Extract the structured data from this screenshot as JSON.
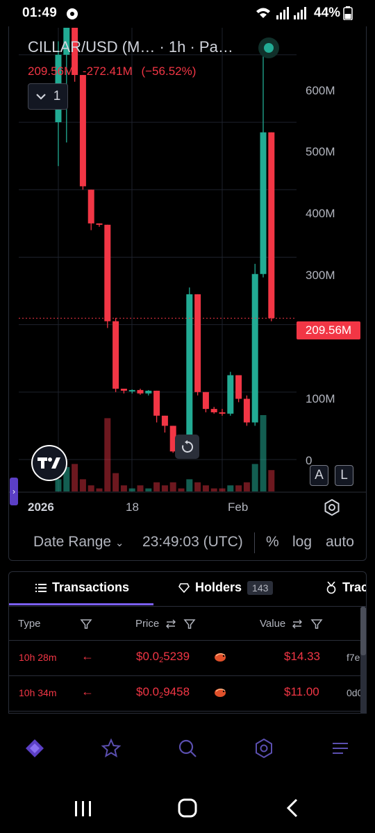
{
  "status_bar": {
    "time": "01:49",
    "battery": "44%"
  },
  "chart": {
    "title": "CILLAR/USD (M…  · 1h · Pa…",
    "stats": {
      "last": "209.56M",
      "change": "-272.41M",
      "change_pct": "(−56.52%)"
    },
    "collapse_count": "1",
    "y_axis_labels": [
      "600M",
      "500M",
      "400M",
      "300M",
      "100M",
      "0"
    ],
    "current_price_tag": "209.56M",
    "x_axis_labels": [
      "2026",
      "18",
      "Feb"
    ],
    "scale_buttons": {
      "auto": "A",
      "log": "L"
    },
    "colors": {
      "up": "#22ab94",
      "down": "#f23645",
      "accent": "#7b5ff0"
    },
    "chart_data": {
      "type": "candlestick",
      "y_unit": "USD (M)",
      "ylim": [
        0,
        640
      ],
      "candles": [
        {
          "o": 500,
          "h": 620,
          "l": 435,
          "c": 600,
          "vol": 4
        },
        {
          "o": 600,
          "h": 640,
          "l": 470,
          "c": 640,
          "vol": 8
        },
        {
          "o": 640,
          "h": 640,
          "l": 560,
          "c": 570,
          "vol": 9
        },
        {
          "o": 570,
          "h": 570,
          "l": 400,
          "c": 405,
          "vol": 4
        },
        {
          "o": 400,
          "h": 400,
          "l": 340,
          "c": 350,
          "vol": 2
        },
        {
          "o": 350,
          "h": 350,
          "l": 345,
          "c": 348,
          "vol": 1
        },
        {
          "o": 348,
          "h": 348,
          "l": 195,
          "c": 205,
          "vol": 24
        },
        {
          "o": 205,
          "h": 210,
          "l": 100,
          "c": 105,
          "vol": 6
        },
        {
          "o": 105,
          "h": 105,
          "l": 98,
          "c": 102,
          "vol": 2
        },
        {
          "o": 102,
          "h": 104,
          "l": 98,
          "c": 103,
          "vol": 1
        },
        {
          "o": 103,
          "h": 105,
          "l": 96,
          "c": 98,
          "vol": 2
        },
        {
          "o": 98,
          "h": 103,
          "l": 95,
          "c": 102,
          "vol": 1
        },
        {
          "o": 102,
          "h": 102,
          "l": 55,
          "c": 65,
          "vol": 3
        },
        {
          "o": 65,
          "h": 65,
          "l": 40,
          "c": 50,
          "vol": 2
        },
        {
          "o": 50,
          "h": 50,
          "l": 10,
          "c": 12,
          "vol": 3
        },
        {
          "o": 12,
          "h": 12,
          "l": 8,
          "c": 10,
          "vol": 1
        },
        {
          "o": 10,
          "h": 255,
          "l": 10,
          "c": 245,
          "vol": 4
        },
        {
          "o": 245,
          "h": 245,
          "l": 95,
          "c": 100,
          "vol": 3
        },
        {
          "o": 100,
          "h": 100,
          "l": 70,
          "c": 75,
          "vol": 2
        },
        {
          "o": 75,
          "h": 78,
          "l": 68,
          "c": 70,
          "vol": 1
        },
        {
          "o": 70,
          "h": 75,
          "l": 65,
          "c": 68,
          "vol": 1
        },
        {
          "o": 68,
          "h": 130,
          "l": 65,
          "c": 125,
          "vol": 2
        },
        {
          "o": 125,
          "h": 125,
          "l": 85,
          "c": 90,
          "vol": 2
        },
        {
          "o": 90,
          "h": 95,
          "l": 50,
          "c": 55,
          "vol": 3
        },
        {
          "o": 55,
          "h": 290,
          "l": 50,
          "c": 275,
          "vol": 9
        },
        {
          "o": 275,
          "h": 620,
          "l": 270,
          "c": 485,
          "vol": 25
        },
        {
          "o": 485,
          "h": 485,
          "l": 205,
          "c": 209.56,
          "vol": 7
        }
      ]
    }
  },
  "chart_toolbar": {
    "date_range": "Date Range",
    "time": "23:49:03 (UTC)",
    "percent": "%",
    "log": "log",
    "auto": "auto"
  },
  "tabs": [
    {
      "label": "Transactions",
      "active": true
    },
    {
      "label": "Holders",
      "badge": "143"
    },
    {
      "label": "Trac"
    }
  ],
  "table": {
    "headers": [
      "Type",
      "Price",
      "Value"
    ],
    "rows": [
      {
        "time": "10h 28m",
        "price_prefix": "$0.0",
        "price_sub": "2",
        "price_rest": "5239",
        "value": "$14.33",
        "maker": "f7e"
      },
      {
        "time": "10h 34m",
        "price_prefix": "$0.0",
        "price_sub": "2",
        "price_rest": "9458",
        "value": "$11.00",
        "maker": "0d0"
      }
    ]
  },
  "bottom_nav": [
    "home",
    "watchlist",
    "search",
    "explore",
    "menu"
  ]
}
